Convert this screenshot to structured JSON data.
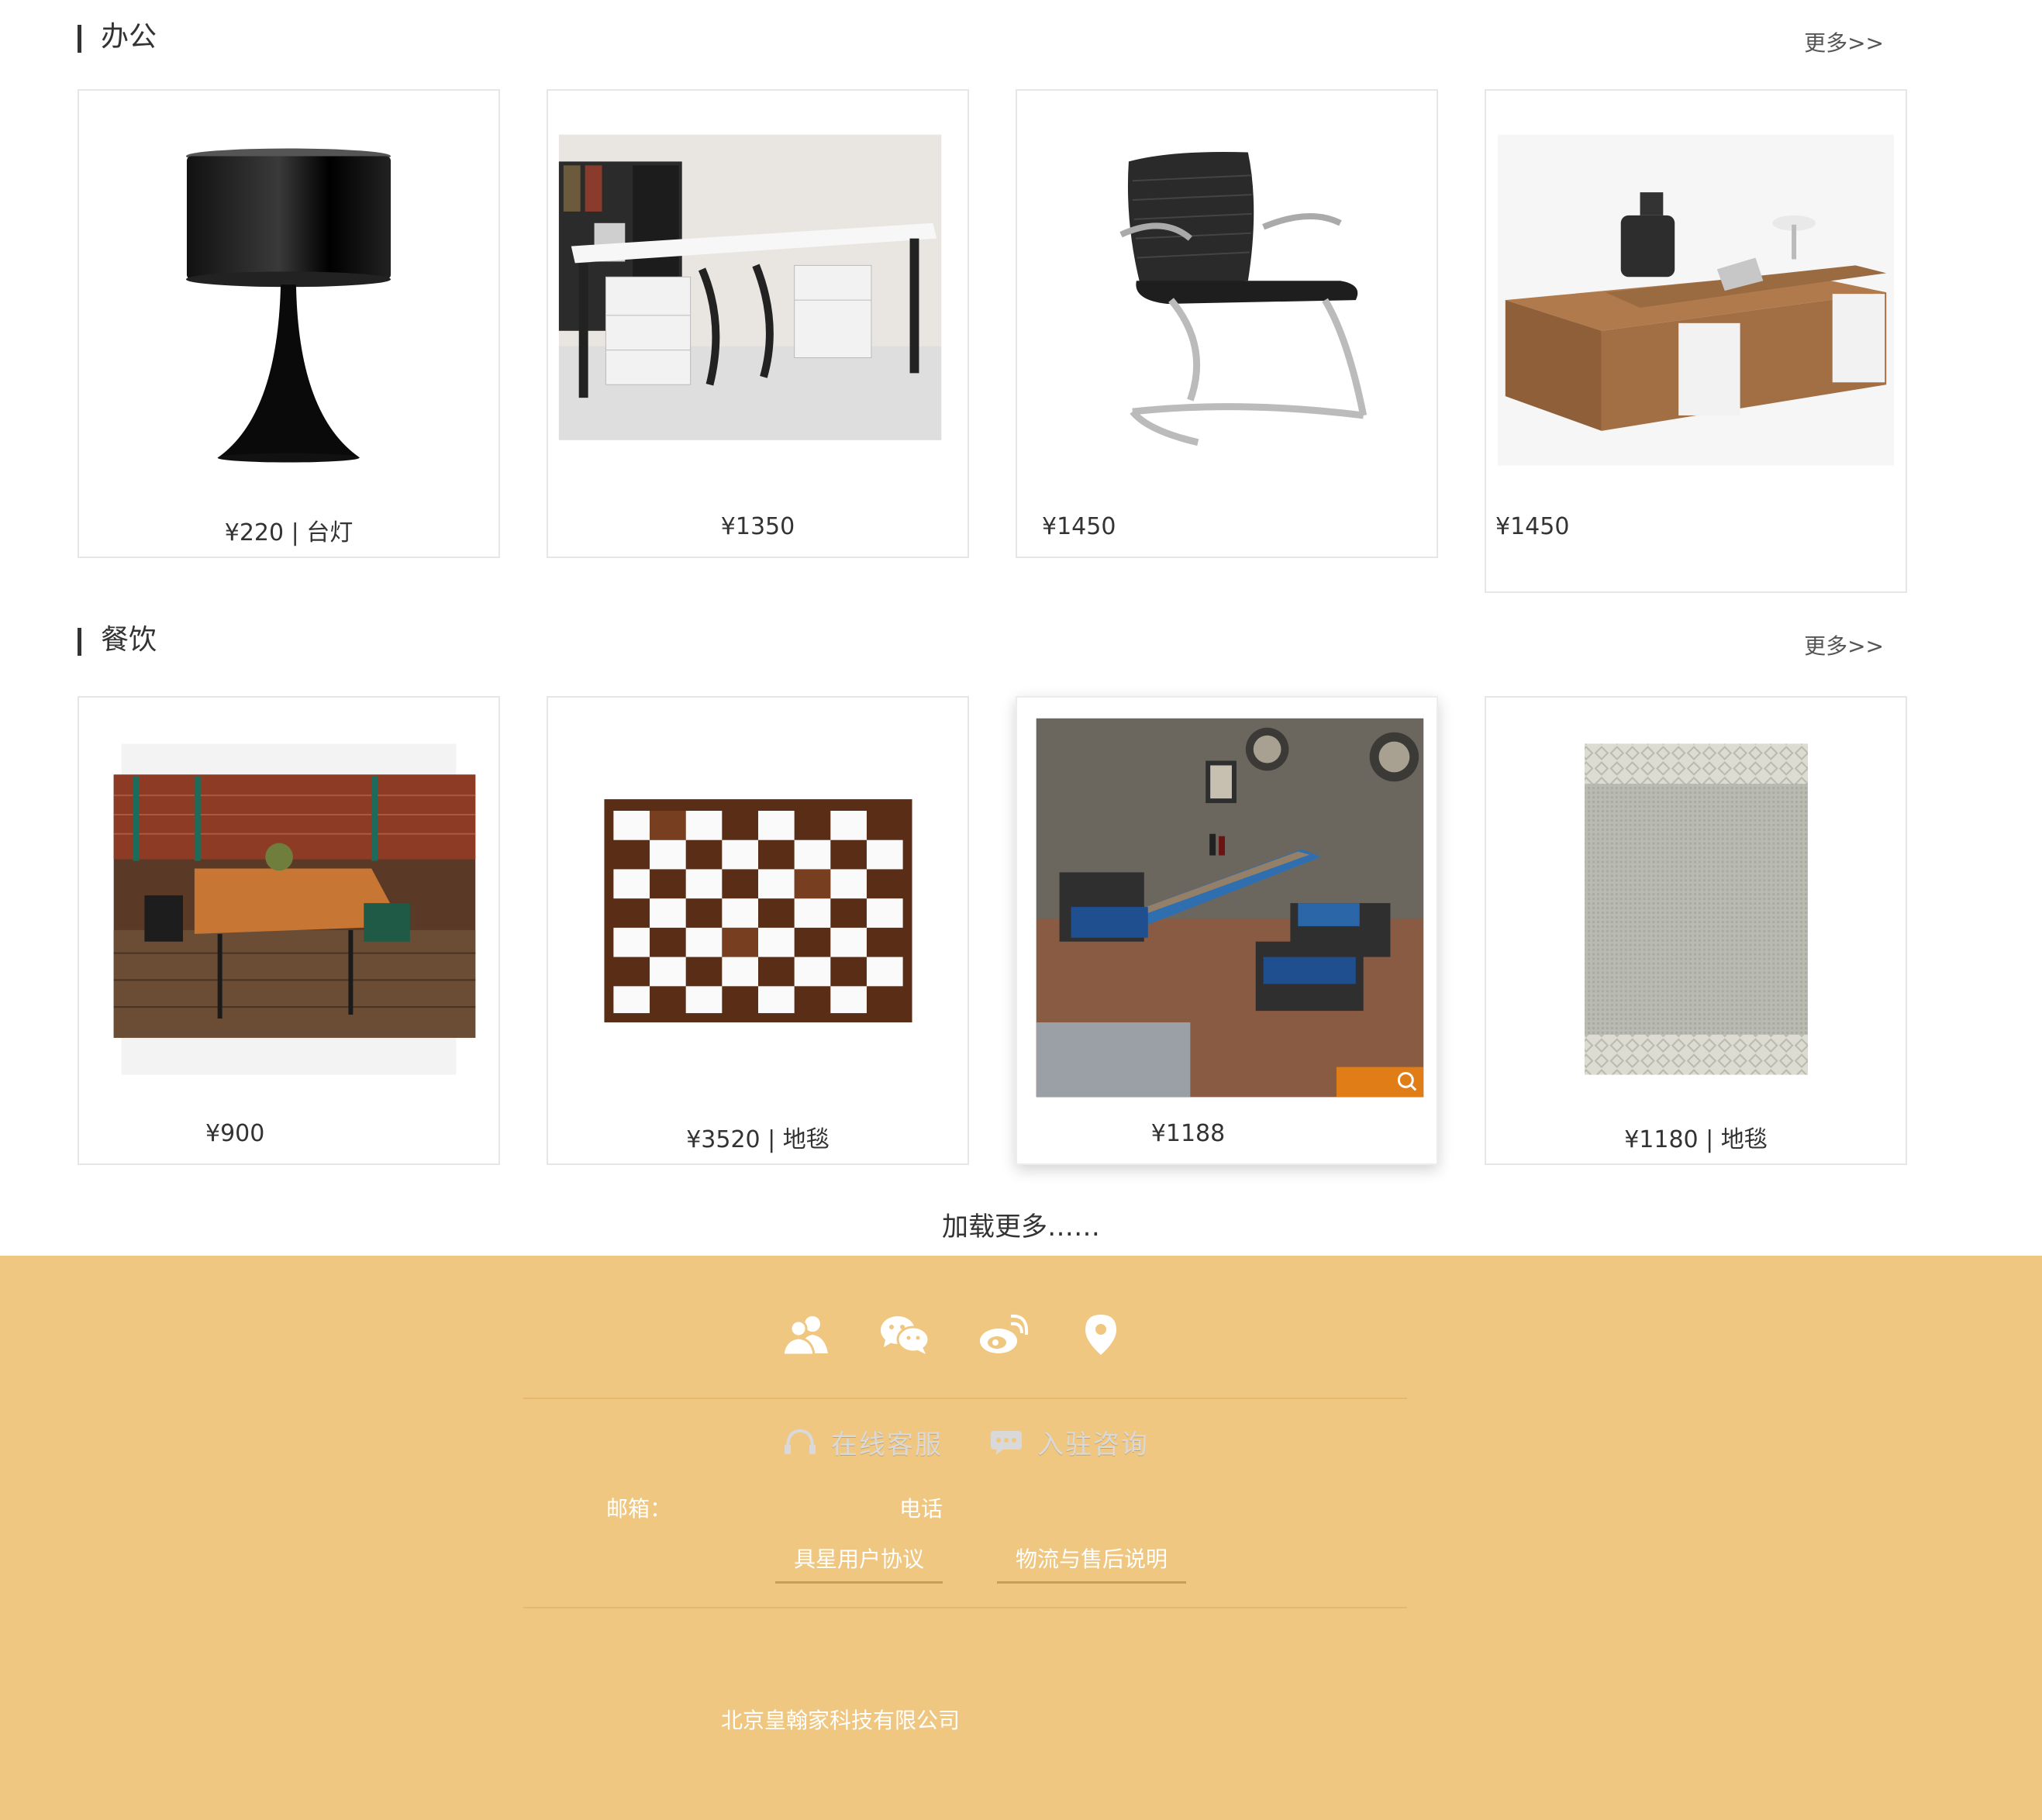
{
  "sections": [
    {
      "title": "办公",
      "more": "更多>>",
      "items": [
        {
          "price": "¥220 | 台灯"
        },
        {
          "price": "¥1350"
        },
        {
          "price": "¥1450"
        },
        {
          "price": "¥1450"
        }
      ]
    },
    {
      "title": "餐饮",
      "more": "更多>>",
      "items": [
        {
          "price": "¥900"
        },
        {
          "price": "¥3520 | 地毯"
        },
        {
          "price": "¥1188"
        },
        {
          "price": "¥1180 | 地毯"
        }
      ]
    }
  ],
  "load_more": "加载更多……",
  "footer": {
    "social_icons": [
      "users-icon",
      "wechat-icon",
      "weibo-icon",
      "location-pin-icon"
    ],
    "service": {
      "online": "在线客服",
      "join": "入驻咨询"
    },
    "email_label": "邮箱：",
    "phone_label": "电话",
    "links": {
      "agreement": "具星用户协议",
      "logistics": "物流与售后说明"
    },
    "company": "北京皇翰家科技有限公司"
  },
  "colors": {
    "footer_bg": "#f0c780",
    "accent_orange": "#e07d16"
  }
}
